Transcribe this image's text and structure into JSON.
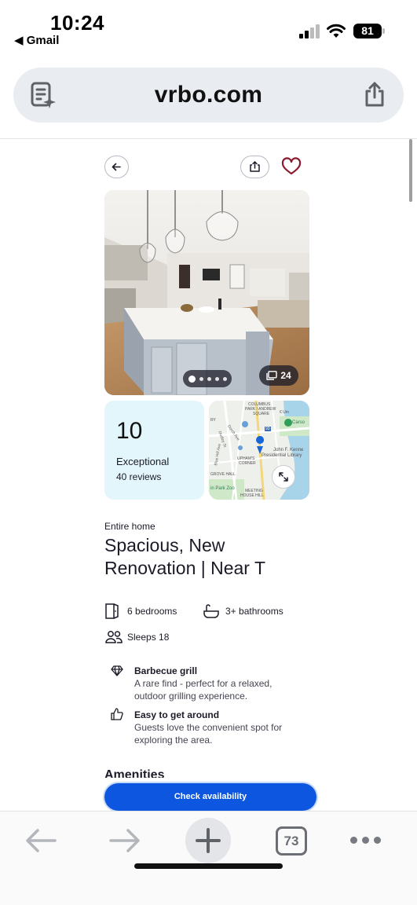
{
  "status_bar": {
    "time": "10:24",
    "back_app": "◀ Gmail",
    "battery": "81"
  },
  "browser": {
    "url": "vrbo.com",
    "tab_count": "73"
  },
  "listing": {
    "photo_count": "24",
    "photo_dots": 5,
    "active_dot": 1,
    "rating": {
      "score": "10",
      "label": "Exceptional",
      "reviews": "40 reviews"
    },
    "map_labels": {
      "columbus": "COLUMBUS",
      "park_andrew": "PARK / ANDREW",
      "square": "SQUARE",
      "john_f_kenne": "John F. Kenne",
      "presidential_library": "Presidential Library",
      "uphams": "UPHAM'S",
      "corner": "CORNER",
      "grove_hall": "GROVE HALL",
      "park_zoo": "in Park Zoo",
      "meeting": "MEETING",
      "house_hill": "HOUSE HILL",
      "carso": "Carso",
      "ry": "RY",
      "route_93": "93",
      "dudley_st": "Dudley St",
      "blue_hill_ave": "Blue Hill Ave",
      "dorch_ave": "Dorch Ave",
      "umm": "€ Um"
    },
    "home_type": "Entire home",
    "title": "Spacious, New Renovation | Near T",
    "bedrooms": "6 bedrooms",
    "bathrooms": "3+ bathrooms",
    "sleeps": "Sleeps 18",
    "highlights": [
      {
        "title": "Barbecue grill",
        "description": "A rare find - perfect for a relaxed, outdoor grilling experience."
      },
      {
        "title": "Easy to get around",
        "description": "Guests love the convenient spot for exploring the area."
      }
    ],
    "amenities_heading": "Amenities",
    "cta": "Check availability"
  },
  "colors": {
    "accent": "#0d57e0",
    "rating_bg": "#e3f6fb",
    "heart": "#8b1a2e",
    "url_bar": "#e9ecf0"
  }
}
